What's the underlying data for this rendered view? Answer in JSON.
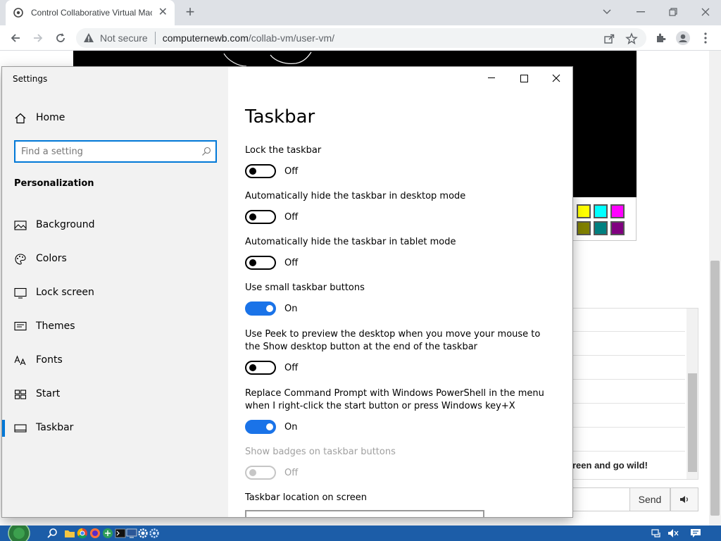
{
  "browser": {
    "tab_title": "Control Collaborative Virtual Machine",
    "security_label": "Not secure",
    "url_host": "computernewb.com",
    "url_path": "/collab-vm/user-vm/"
  },
  "chat": {
    "message": "reen and go wild!",
    "send_label": "Send"
  },
  "palette": {
    "row1": [
      "#ffff00",
      "#00ffff",
      "#ff00ff"
    ],
    "row2": [
      "#808000",
      "#008080",
      "#800080"
    ]
  },
  "settings": {
    "window_title": "Settings",
    "home_label": "Home",
    "search_placeholder": "Find a setting",
    "section_title": "Personalization",
    "nav": [
      {
        "label": "Background",
        "icon": "picture-icon"
      },
      {
        "label": "Colors",
        "icon": "palette-icon"
      },
      {
        "label": "Lock screen",
        "icon": "monitor-icon"
      },
      {
        "label": "Themes",
        "icon": "brush-icon"
      },
      {
        "label": "Fonts",
        "icon": "font-icon"
      },
      {
        "label": "Start",
        "icon": "start-grid-icon"
      },
      {
        "label": "Taskbar",
        "icon": "taskbar-icon"
      }
    ],
    "active_nav": "Taskbar",
    "heading": "Taskbar",
    "options": [
      {
        "label": "Lock the taskbar",
        "state": "Off"
      },
      {
        "label": "Automatically hide the taskbar in desktop mode",
        "state": "Off"
      },
      {
        "label": "Automatically hide the taskbar in tablet mode",
        "state": "Off"
      },
      {
        "label": "Use small taskbar buttons",
        "state": "On"
      },
      {
        "label": "Use Peek to preview the desktop when you move your mouse to the Show desktop button at the end of the taskbar",
        "state": "Off"
      },
      {
        "label": "Replace Command Prompt with Windows PowerShell in the menu when I right-click the start button or press Windows key+X",
        "state": "On"
      },
      {
        "label": "Show badges on taskbar buttons",
        "state": "Off",
        "disabled": true
      }
    ],
    "location_label": "Taskbar location on screen"
  },
  "colors": {
    "accent": "#0078d7",
    "toggle_on": "#1a73e8",
    "taskbar": "#1c5da8"
  }
}
